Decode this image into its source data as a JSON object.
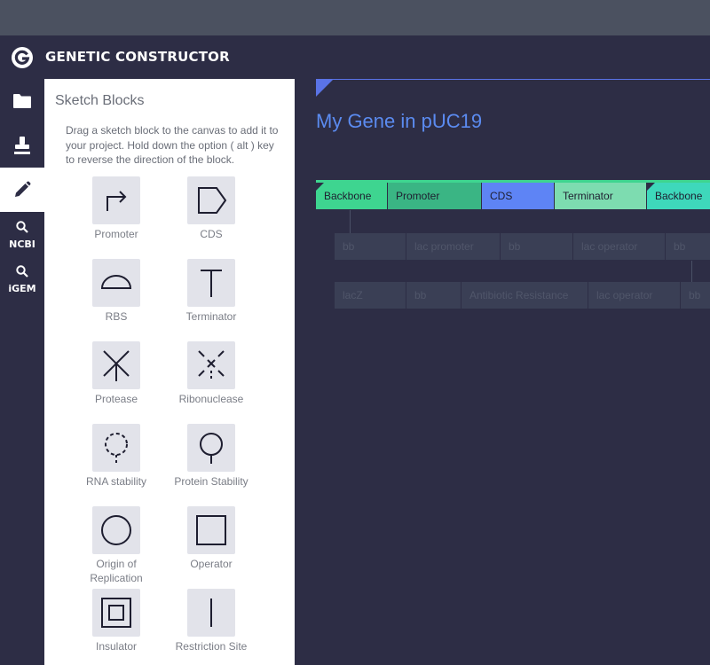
{
  "app": {
    "title": "GENETIC CONSTRUCTOR"
  },
  "nav": {
    "items": [
      {
        "id": "projects",
        "icon": "folder-icon"
      },
      {
        "id": "inventory",
        "icon": "stamp-icon"
      },
      {
        "id": "sketch",
        "icon": "pencil-icon",
        "active": true
      },
      {
        "id": "ncbi",
        "icon": "search-icon",
        "label": "NCBI"
      },
      {
        "id": "igem",
        "icon": "search-icon",
        "label": "iGEM"
      }
    ]
  },
  "panel": {
    "title": "Sketch Blocks",
    "description": "Drag a sketch block to the canvas to add it to your project. Hold down the option ( alt ) key to reverse the direction of the block.",
    "blocks": [
      {
        "label": "Promoter",
        "icon": "promoter-icon"
      },
      {
        "label": "CDS",
        "icon": "cds-icon"
      },
      {
        "label": "RBS",
        "icon": "rbs-icon"
      },
      {
        "label": "Terminator",
        "icon": "terminator-icon"
      },
      {
        "label": "Protease",
        "icon": "protease-icon"
      },
      {
        "label": "Ribonuclease",
        "icon": "ribonuclease-icon"
      },
      {
        "label": "RNA stability",
        "icon": "rna-stability-icon"
      },
      {
        "label": "Protein Stability",
        "icon": "protein-stability-icon"
      },
      {
        "label": "Origin of Replication",
        "icon": "origin-of-replication-icon"
      },
      {
        "label": "Operator",
        "icon": "operator-icon"
      },
      {
        "label": "Insulator",
        "icon": "insulator-icon"
      },
      {
        "label": "Restriction Site",
        "icon": "restriction-site-icon"
      }
    ]
  },
  "canvas": {
    "construct_title": "My Gene in pUC19",
    "parts": [
      {
        "label": "Backbone",
        "color": "#3ed590"
      },
      {
        "label": "Promoter",
        "color": "#3ab584"
      },
      {
        "label": "CDS",
        "color": "#5e84f5"
      },
      {
        "label": "Terminator",
        "color": "#7ddcb0"
      },
      {
        "label": "Backbone",
        "color": "#3ed8bb"
      }
    ],
    "subrow1": [
      "bb",
      "lac promoter",
      "bb",
      "lac operator",
      "bb"
    ],
    "subrow2": [
      "lacZ",
      "bb",
      "Antibiotic Resistance",
      "lac operator",
      "bb"
    ]
  }
}
